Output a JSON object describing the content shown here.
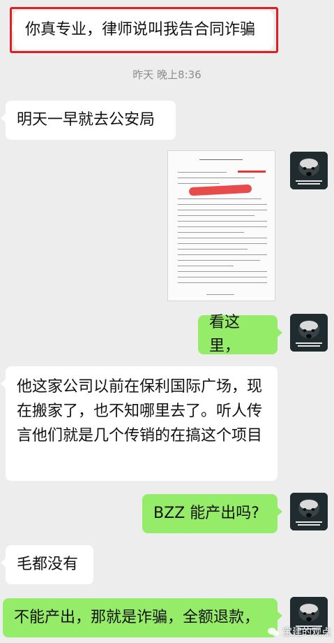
{
  "messages": {
    "m1": "你真专业，律师说叫我告合同诈骗",
    "timestamp": "昨天 晚上8:36",
    "m2": "明天一早就去公安局",
    "m3": "看这里，",
    "m4": "他这家公司以前在保利国际广场，现在搬家了，也不知哪里去了。听人传言他们就是几个传销的在搞这个项目",
    "m5": "BZZ 能产出吗?",
    "m6": "毛都没有",
    "m7": "不能产出，那就是诈骗，全额退款，"
  },
  "watermark": {
    "text": "宝建的观点"
  },
  "colors": {
    "background": "#ededed",
    "sent_bubble": "#95ec69",
    "received_bubble": "#ffffff",
    "highlight": "#e02020"
  }
}
